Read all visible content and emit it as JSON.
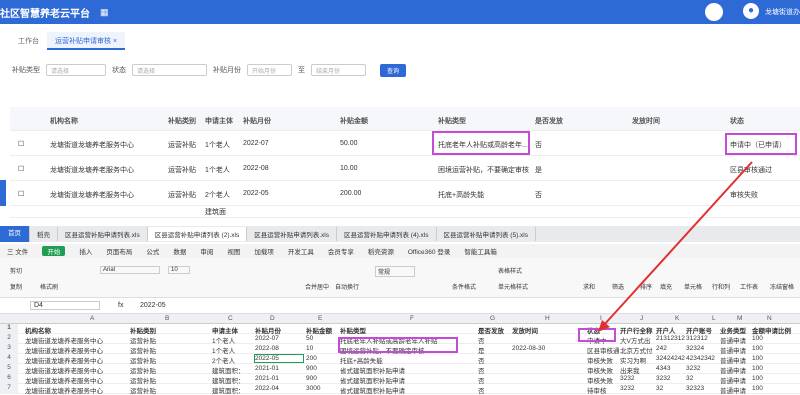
{
  "app": {
    "title": "社区智慧养老云平台",
    "menu_icon": "grid-icon",
    "user": "龙塘街道办"
  },
  "tabs": [
    {
      "label": "工作台"
    },
    {
      "label": "运营补贴申请审核",
      "close": "×"
    }
  ],
  "filters": {
    "type_label": "补贴类型",
    "type_placeholder": "请选择",
    "status_label": "状态",
    "status_placeholder": "请选择",
    "month_label": "补贴月份",
    "start_placeholder": "开始月份",
    "sep": "至",
    "end_placeholder": "结束月份",
    "query": "查询"
  },
  "table": {
    "headers": [
      "机构名称",
      "补贴类别",
      "申请主体",
      "补贴月份",
      "补贴金额",
      "补贴类型",
      "是否发放",
      "发放时间",
      "状态"
    ],
    "rows": [
      [
        "龙塘街道龙塘养老服务中心",
        "运营补贴",
        "1个老人",
        "2022-07",
        "50.00",
        "托底老年人补贴或高龄老年...",
        "否",
        "",
        "申请中（已申请）"
      ],
      [
        "龙塘街道龙塘养老服务中心",
        "运营补贴",
        "1个老人",
        "2022-08",
        "10.00",
        "困境运营补贴，不要确定审核",
        "是",
        "",
        "区县审核通过"
      ],
      [
        "龙塘街道龙塘养老服务中心",
        "运营补贴",
        "2个老人",
        "2022-05",
        "200.00",
        "托底+高龄失能",
        "否",
        "",
        "审核失败"
      ]
    ],
    "partial": "建筑面"
  },
  "sheet_tabs": [
    "首页",
    "稻壳",
    "区县运营补贴申请列表.xls",
    "区县运营补贴申请列表 (2).xls",
    "区县运营补贴申请列表.xls",
    "区县运营补贴申请列表 (4).xls",
    "区县运营补贴申请列表 (5).xls"
  ],
  "menu": [
    "三 文件",
    "开始",
    "插入",
    "页面布局",
    "公式",
    "数据",
    "审阅",
    "视图",
    "加载项",
    "开发工具",
    "会员专享",
    "稻壳资源",
    "Office360 登录",
    "智能工具箱"
  ],
  "ribbon": {
    "cut": "剪切",
    "copy": "复制",
    "painter": "格式刷",
    "font": "Arial",
    "size": "10",
    "merge": "合并居中",
    "wrap": "自动换行",
    "fmt": "常规",
    "table_style": "表格样式",
    "sum": "求和",
    "filter": "筛选",
    "sort": "排序",
    "fill": "填充",
    "cell": "单元格",
    "rowcol": "行和列",
    "ws": "工作表",
    "freeze": "冻结窗格",
    "cond": "条件格式",
    "cellstyle": "单元格样式"
  },
  "formula": {
    "cell": "D4",
    "fx": "fx",
    "value": "2022-05"
  },
  "grid": {
    "cols": [
      "A",
      "B",
      "C",
      "D",
      "E",
      "F",
      "G",
      "H",
      "I",
      "J",
      "K",
      "L",
      "M",
      "N"
    ],
    "rows": [
      [
        "1",
        "机构名称",
        "补贴类别",
        "申请主体",
        "补贴月份",
        "补贴金额",
        "补贴类型",
        "是否发放",
        "发放时间",
        "状态",
        "开户行全称",
        "开户人",
        "开户账号",
        "业务类型",
        "金额申请比例"
      ],
      [
        "2",
        "龙塘街道龙塘养老服务中心",
        "运营补贴",
        "1个老人",
        "2022-07",
        "50",
        "托底老年人补贴或高龄老年人补贴",
        "否",
        "",
        "申请中",
        "大V方式出",
        "21312312",
        "312312",
        "普通申请",
        "100"
      ],
      [
        "3",
        "龙塘街道龙塘养老服务中心",
        "运营补贴",
        "1个老人",
        "2022-08",
        "10",
        "困境运营补贴，不要确定审核",
        "是",
        "2022-08-30",
        "区县审核通",
        "北京方式付",
        "242",
        "32324",
        "普通申请",
        "100"
      ],
      [
        "4",
        "龙塘街道龙塘养老服务中心",
        "运营补贴",
        "2个老人",
        "2022-05",
        "200",
        "托底+高龄失能",
        "否",
        "",
        "审核失败",
        "实习为啊",
        "32424242",
        "42342342",
        "普通申请",
        "100"
      ],
      [
        "5",
        "龙塘街道龙塘养老服务中心",
        "运营补贴",
        "建筑面积：",
        "2021-01",
        "900",
        "省式建筑面积补贴申请",
        "否",
        "",
        "审核失败",
        "出来我",
        "4343",
        "3232",
        "普通申请",
        "100"
      ],
      [
        "6",
        "龙塘街道龙塘养老服务中心",
        "运营补贴",
        "建筑面积：",
        "2021-01",
        "900",
        "省式建筑面积补贴申请",
        "否",
        "",
        "审核失败",
        "3232",
        "3232",
        "32",
        "普通申请",
        "100"
      ],
      [
        "7",
        "龙塘街道龙塘养老服务中心",
        "运营补贴",
        "建筑面积：",
        "2022-04",
        "3000",
        "省式建筑面积补贴申请",
        "否",
        "",
        "待审核",
        "3232",
        "32",
        "32323",
        "普通申请",
        "100"
      ]
    ]
  },
  "colors": {
    "primary": "#2d6ad6",
    "highlight": "#c44ad7",
    "arrow": "#e03030"
  }
}
